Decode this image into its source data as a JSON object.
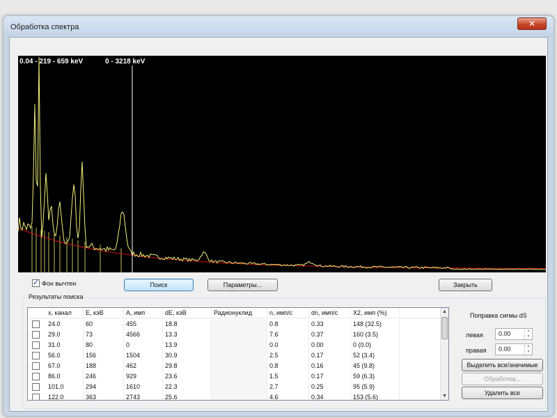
{
  "window": {
    "title": "Обработка спектра",
    "close_glyph": "✕"
  },
  "spectrum": {
    "range_a": "0.04 - 219 - 659 keV",
    "range_b": "0 - 3218 keV",
    "colors": {
      "background": "#000000",
      "spectrum": "#f0f078",
      "baseline": "#d01010",
      "marker": "#ffffff",
      "peaks": "#f0f078"
    }
  },
  "controls": {
    "bg_subtracted_label": "Фон вычтен",
    "bg_subtracted_checked": true,
    "search_label": "Поиск",
    "params_label": "Параметры...",
    "close_label": "Закрыть"
  },
  "results": {
    "group_title": "Результаты поиска",
    "columns": [
      "x, канал",
      "E, кэВ",
      "A, имп",
      "dE, кэВ",
      "Радионуклид",
      "n, имп/с",
      "dn, имп/с",
      "X2, имп (%)"
    ],
    "rows": [
      [
        "24.0",
        "60",
        "455",
        "18.8",
        "",
        "0.8",
        "0.33",
        "148  (32.5)"
      ],
      [
        "29.0",
        "73",
        "4566",
        "13.3",
        "",
        "7.6",
        "0.37",
        "160  (3.5)"
      ],
      [
        "31.0",
        "80",
        "0",
        "13.9",
        "",
        "0.0",
        "0.00",
        "0  (0.0)"
      ],
      [
        "56.0",
        "156",
        "1504",
        "30.9",
        "",
        "2.5",
        "0.17",
        "52  (3.4)"
      ],
      [
        "67.0",
        "188",
        "462",
        "29.8",
        "",
        "0.8",
        "0.16",
        "45  (9.8)"
      ],
      [
        "86.0",
        "246",
        "929",
        "23.6",
        "",
        "1.5",
        "0.17",
        "59  (6.3)"
      ],
      [
        "101.0",
        "294",
        "1610",
        "22.3",
        "",
        "2.7",
        "0.25",
        "95  (5.9)"
      ],
      [
        "122.0",
        "363",
        "2743",
        "25.6",
        "",
        "4.6",
        "0.34",
        "153  (5.6)"
      ]
    ]
  },
  "sigma": {
    "title": "Поправка сигмы dS",
    "left_label": "левая",
    "left_value": "0.00",
    "right_label": "правая",
    "right_value": "0.00",
    "select_label": "Выделить все/значимые",
    "process_label": "Обработка...",
    "delete_label": "Удалить все"
  }
}
